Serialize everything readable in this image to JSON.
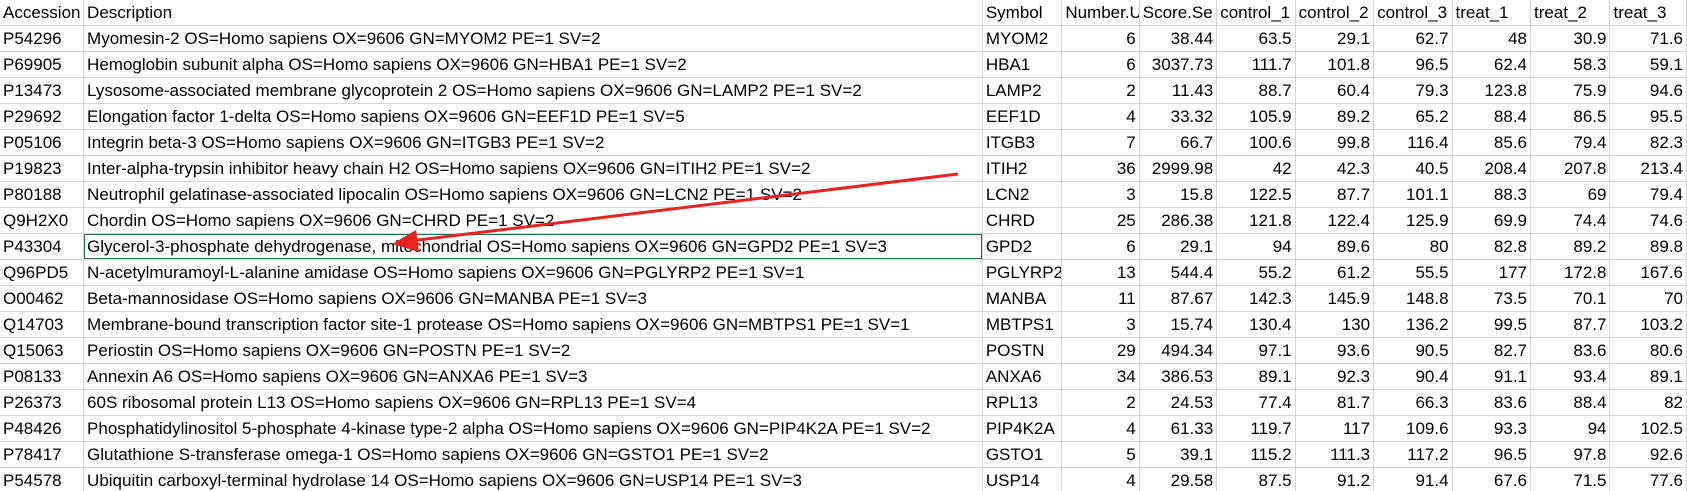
{
  "sheet": {
    "columns": [
      "Accession",
      "Description",
      "Symbol",
      "Number.U",
      "Score.Se",
      "control_1",
      "control_2",
      "control_3",
      "treat_1",
      "treat_2",
      "treat_3"
    ],
    "rows": [
      [
        "P54296",
        "Myomesin-2 OS=Homo sapiens OX=9606 GN=MYOM2 PE=1 SV=2",
        "MYOM2",
        "6",
        "38.44",
        "63.5",
        "29.1",
        "62.7",
        "48",
        "30.9",
        "71.6"
      ],
      [
        "P69905",
        "Hemoglobin subunit alpha OS=Homo sapiens OX=9606 GN=HBA1 PE=1 SV=2",
        "HBA1",
        "6",
        "3037.73",
        "111.7",
        "101.8",
        "96.5",
        "62.4",
        "58.3",
        "59.1"
      ],
      [
        "P13473",
        "Lysosome-associated membrane glycoprotein 2 OS=Homo sapiens OX=9606 GN=LAMP2 PE=1 SV=2",
        "LAMP2",
        "2",
        "11.43",
        "88.7",
        "60.4",
        "79.3",
        "123.8",
        "75.9",
        "94.6"
      ],
      [
        "P29692",
        "Elongation factor 1-delta OS=Homo sapiens OX=9606 GN=EEF1D PE=1 SV=5",
        "EEF1D",
        "4",
        "33.32",
        "105.9",
        "89.2",
        "65.2",
        "88.4",
        "86.5",
        "95.5"
      ],
      [
        "P05106",
        "Integrin beta-3 OS=Homo sapiens OX=9606 GN=ITGB3 PE=1 SV=2",
        "ITGB3",
        "7",
        "66.7",
        "100.6",
        "99.8",
        "116.4",
        "85.6",
        "79.4",
        "82.3"
      ],
      [
        "P19823",
        "Inter-alpha-trypsin inhibitor heavy chain H2 OS=Homo sapiens OX=9606 GN=ITIH2 PE=1 SV=2",
        "ITIH2",
        "36",
        "2999.98",
        "42",
        "42.3",
        "40.5",
        "208.4",
        "207.8",
        "213.4"
      ],
      [
        "P80188",
        "Neutrophil gelatinase-associated lipocalin OS=Homo sapiens OX=9606 GN=LCN2 PE=1 SV=2",
        "LCN2",
        "3",
        "15.8",
        "122.5",
        "87.7",
        "101.1",
        "88.3",
        "69",
        "79.4"
      ],
      [
        "Q9H2X0",
        "Chordin OS=Homo sapiens OX=9606 GN=CHRD PE=1 SV=2",
        "CHRD",
        "25",
        "286.38",
        "121.8",
        "122.4",
        "125.9",
        "69.9",
        "74.4",
        "74.6"
      ],
      [
        "P43304",
        "Glycerol-3-phosphate dehydrogenase, mitochondrial OS=Homo sapiens OX=9606 GN=GPD2 PE=1 SV=3",
        "GPD2",
        "6",
        "29.1",
        "94",
        "89.6",
        "80",
        "82.8",
        "89.2",
        "89.8"
      ],
      [
        "Q96PD5",
        "N-acetylmuramoyl-L-alanine amidase OS=Homo sapiens OX=9606 GN=PGLYRP2 PE=1 SV=1",
        "PGLYRP2",
        "13",
        "544.4",
        "55.2",
        "61.2",
        "55.5",
        "177",
        "172.8",
        "167.6"
      ],
      [
        "O00462",
        "Beta-mannosidase OS=Homo sapiens OX=9606 GN=MANBA PE=1 SV=3",
        "MANBA",
        "11",
        "87.67",
        "142.3",
        "145.9",
        "148.8",
        "73.5",
        "70.1",
        "70"
      ],
      [
        "Q14703",
        "Membrane-bound transcription factor site-1 protease OS=Homo sapiens OX=9606 GN=MBTPS1 PE=1 SV=1",
        "MBTPS1",
        "3",
        "15.74",
        "130.4",
        "130",
        "136.2",
        "99.5",
        "87.7",
        "103.2"
      ],
      [
        "Q15063",
        "Periostin OS=Homo sapiens OX=9606 GN=POSTN PE=1 SV=2",
        "POSTN",
        "29",
        "494.34",
        "97.1",
        "93.6",
        "90.5",
        "82.7",
        "83.6",
        "80.6"
      ],
      [
        "P08133",
        "Annexin A6 OS=Homo sapiens OX=9606 GN=ANXA6 PE=1 SV=3",
        "ANXA6",
        "34",
        "386.53",
        "89.1",
        "92.3",
        "90.4",
        "91.1",
        "93.4",
        "89.1"
      ],
      [
        "P26373",
        "60S ribosomal protein L13 OS=Homo sapiens OX=9606 GN=RPL13 PE=1 SV=4",
        "RPL13",
        "2",
        "24.53",
        "77.4",
        "81.7",
        "66.3",
        "83.6",
        "88.4",
        "82"
      ],
      [
        "P48426",
        "Phosphatidylinositol 5-phosphate 4-kinase type-2 alpha OS=Homo sapiens OX=9606 GN=PIP4K2A PE=1 SV=2",
        "PIP4K2A",
        "4",
        "61.33",
        "119.7",
        "117",
        "109.6",
        "93.3",
        "94",
        "102.5"
      ],
      [
        "P78417",
        "Glutathione S-transferase omega-1 OS=Homo sapiens OX=9606 GN=GSTO1 PE=1 SV=2",
        "GSTO1",
        "5",
        "39.1",
        "115.2",
        "111.3",
        "117.2",
        "96.5",
        "97.8",
        "92.6"
      ],
      [
        "P54578",
        "Ubiquitin carboxyl-terminal hydrolase 14 OS=Homo sapiens OX=9606 GN=USP14 PE=1 SV=3",
        "USP14",
        "4",
        "29.58",
        "87.5",
        "91.2",
        "91.4",
        "67.6",
        "71.5",
        "77.6"
      ]
    ],
    "selected_row": 8,
    "colors": {
      "selection_border": "#217346",
      "gridline": "#d4d4d4",
      "arrow": "#e8231f"
    }
  }
}
